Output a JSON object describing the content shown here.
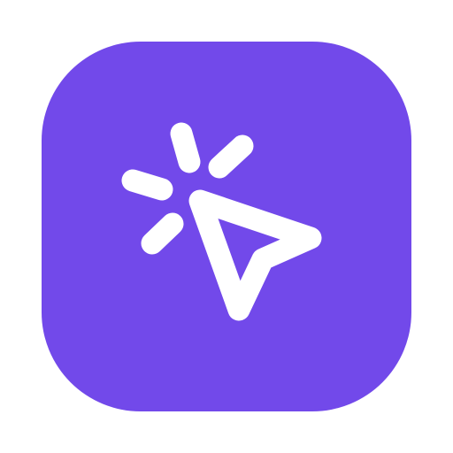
{
  "icon": {
    "name": "click-cursor-icon",
    "background_color": "#7249EA",
    "glyph_color": "#FFFFFF",
    "page_background": "#FFFFFF"
  }
}
